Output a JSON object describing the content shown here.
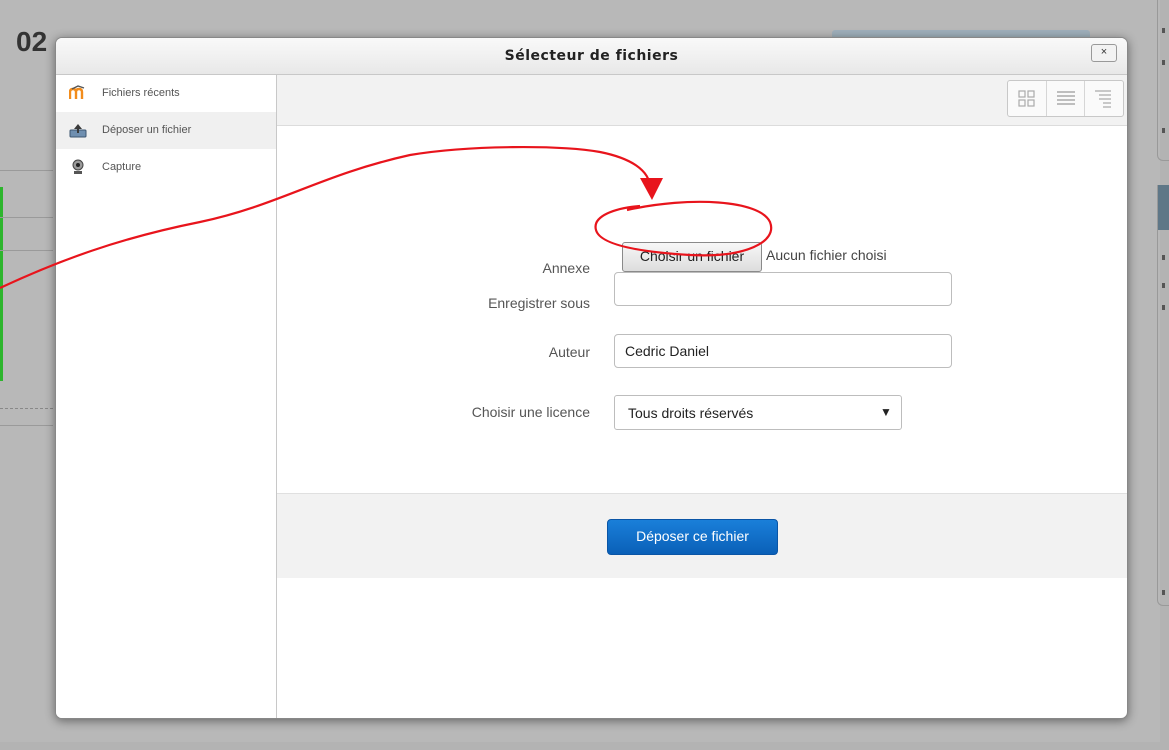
{
  "background": {
    "title_fragment": "02"
  },
  "dialog": {
    "title": "Sélecteur de fichiers",
    "close_label": "×"
  },
  "sidebar": {
    "items": [
      {
        "label": "Fichiers récents",
        "icon": "moodle-icon",
        "active": false
      },
      {
        "label": "Déposer un fichier",
        "icon": "upload-icon",
        "active": true
      },
      {
        "label": "Capture",
        "icon": "webcam-icon",
        "active": false
      }
    ]
  },
  "toolbar": {
    "views": [
      "icons-view-icon",
      "list-view-icon",
      "tree-view-icon"
    ]
  },
  "form": {
    "attachment_label": "Annexe",
    "choose_button_label": "Choisir un fichier",
    "no_file_text": "Aucun fichier choisi",
    "save_as_label": "Enregistrer sous",
    "save_as_value": "",
    "author_label": "Auteur",
    "author_value": "Cedric Daniel",
    "license_label": "Choisir une licence",
    "license_value": "Tous droits réservés",
    "license_arrow": "▼",
    "submit_label": "Déposer ce fichier"
  },
  "colors": {
    "primary": "#0a6cc9",
    "annotation": "#e8141c",
    "highlight_green": "#2db52d"
  }
}
